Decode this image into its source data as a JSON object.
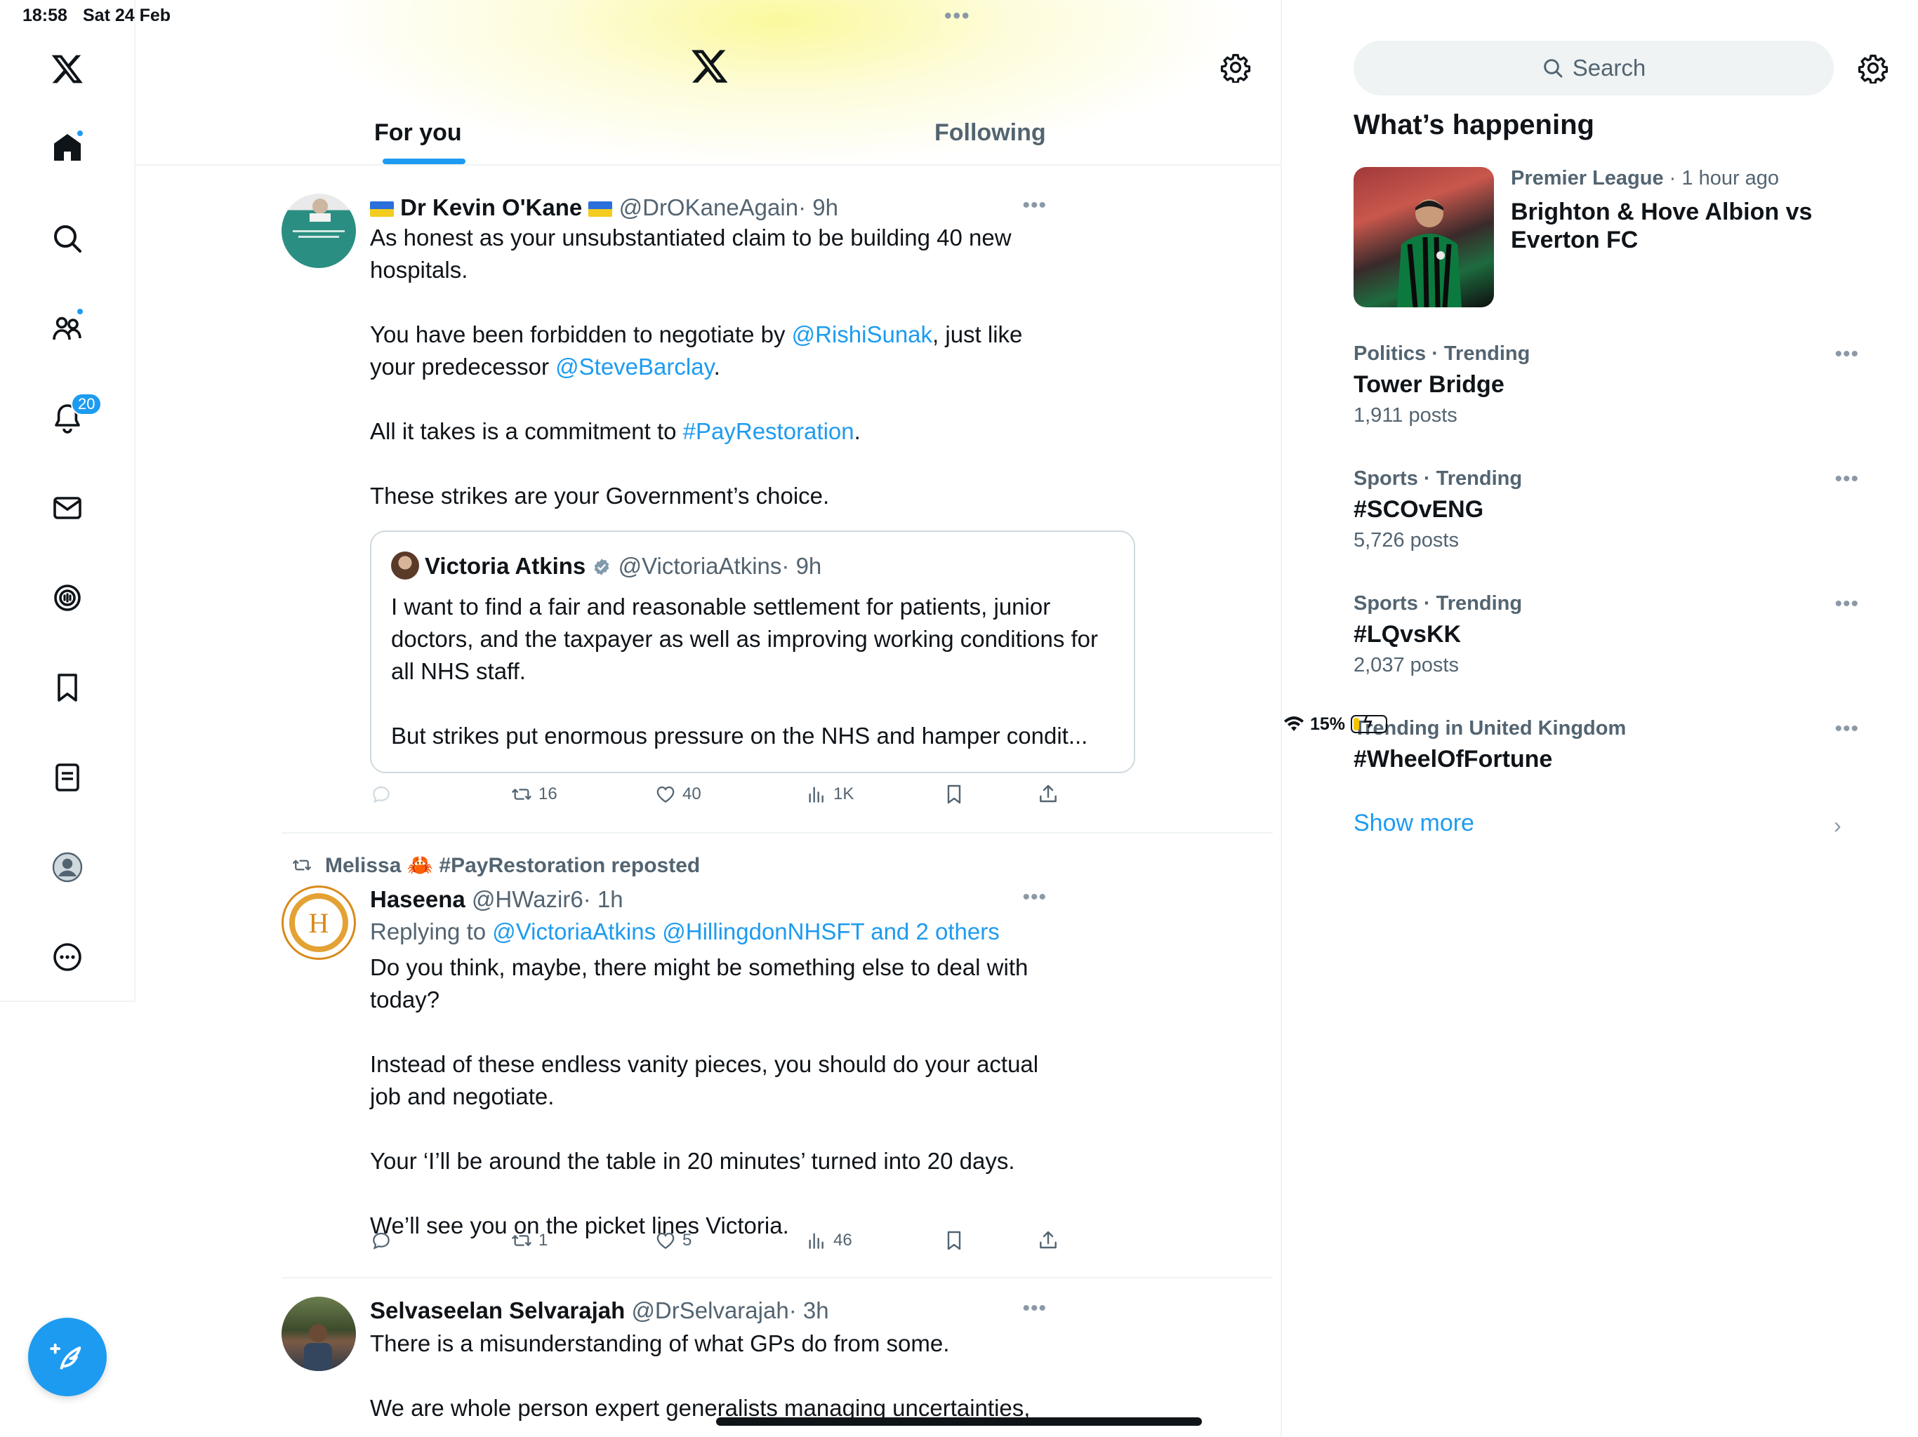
{
  "status": {
    "time": "18:58",
    "date": "Sat 24 Feb",
    "battery": "15%"
  },
  "nav": {
    "notifications_badge": "20"
  },
  "tabs": {
    "for_you": "For you",
    "following": "Following"
  },
  "tweets": [
    {
      "name": "Dr Kevin O'Kane",
      "handle": "@DrOKaneAgain",
      "time": "· 9h",
      "p1": "As honest as your unsubstantiated claim to be building 40 new hospitals.",
      "p2_a": "You have been forbidden to negotiate by ",
      "p2_link1": "@RishiSunak",
      "p2_b": ", just like your predecessor ",
      "p2_link2": "@SteveBarclay",
      "p2_c": ".",
      "p3_a": "All it takes is a commitment to ",
      "p3_link": "#PayRestoration",
      "p3_b": ".",
      "p4": "These strikes are your Government’s choice.",
      "quote": {
        "name": "Victoria Atkins",
        "handle": "@VictoriaAtkins",
        "time": "· 9h",
        "p1": "I want to find a fair and reasonable settlement for patients, junior doctors, and the taxpayer as well as improving working conditions for all NHS staff.",
        "p2": "But strikes put enormous pressure on the NHS and hamper condit..."
      },
      "retweets": "16",
      "likes": "40",
      "views": "1K"
    },
    {
      "reposted_by": "Melissa 🦀 #PayRestoration reposted",
      "name": "Haseena",
      "handle": "@HWazir6",
      "time": "· 1h",
      "replying_prefix": "Replying to ",
      "replying_to": "@VictoriaAtkins @HillingdonNHSFT and 2 others",
      "p1": "Do you think, maybe, there might be something else to deal with today?",
      "p2": "Instead of these endless vanity pieces, you should do your actual job and negotiate.",
      "p3": "Your ‘I’ll be around the table in 20 minutes’ turned into 20 days.",
      "p4": "We’ll see you on the picket lines Victoria.",
      "retweets": "1",
      "likes": "5",
      "views": "46"
    },
    {
      "name": "Selvaseelan Selvarajah",
      "handle": "@DrSelvarajah",
      "time": "· 3h",
      "p1": "There is a misunderstanding of what GPs do from some.",
      "p2": "We are whole person expert generalists managing uncertainties,"
    }
  ],
  "sidebar": {
    "search_placeholder": "Search",
    "title": "What’s happening",
    "featured": {
      "category": "Premier League",
      "time": "· 1 hour ago",
      "title": "Brighton & Hove Albion vs Everton FC"
    },
    "trends": [
      {
        "category": "Politics · Trending",
        "name": "Tower Bridge",
        "count": "1,911 posts"
      },
      {
        "category": "Sports · Trending",
        "name": "#SCOvENG",
        "count": "5,726 posts"
      },
      {
        "category": "Sports · Trending",
        "name": "#LQvsKK",
        "count": "2,037 posts"
      },
      {
        "category": "Trending in United Kingdom",
        "name": "#WheelOfFortune",
        "count": ""
      }
    ],
    "show_more": "Show more"
  },
  "colors": {
    "accent": "#1d9bf0",
    "text": "#0f1419",
    "muted": "#536471",
    "border": "#eff3f4"
  },
  "icons": [
    "x-logo-icon",
    "home-icon",
    "search-icon",
    "communities-icon",
    "bell-icon",
    "mail-icon",
    "grok-icon",
    "bookmark-icon",
    "lists-icon",
    "profile-icon",
    "more-circle-icon",
    "compose-icon",
    "settings-icon",
    "reply-icon",
    "retweet-icon",
    "like-icon",
    "views-icon",
    "share-icon",
    "verified-icon"
  ]
}
